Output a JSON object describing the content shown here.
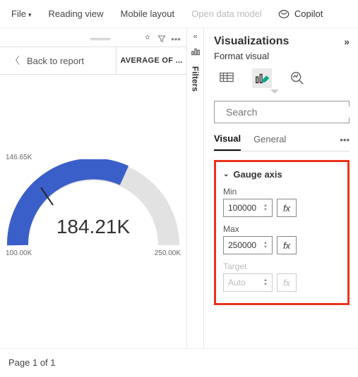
{
  "topbar": {
    "file": "File",
    "reading_view": "Reading view",
    "mobile_layout": "Mobile layout",
    "open_data_model": "Open data model",
    "copilot": "Copilot"
  },
  "canvas": {
    "back_to_report": "Back to report",
    "visual_title": "AVERAGE OF ...",
    "gauge": {
      "pointer_label": "146.65K",
      "value_display": "184.21K",
      "min_label": "100.00K",
      "max_label": "250.00K"
    }
  },
  "filters_rail": {
    "label": "Filters"
  },
  "viz_pane": {
    "title": "Visualizations",
    "subtitle": "Format visual",
    "search_placeholder": "Search",
    "tabs": {
      "visual": "Visual",
      "general": "General"
    },
    "section": {
      "title": "Gauge axis",
      "min_label": "Min",
      "min_value": "100000",
      "max_label": "Max",
      "max_value": "250000",
      "target_label": "Target",
      "target_value": "Auto",
      "fx": "fx"
    }
  },
  "footer": {
    "page_text": "Page 1 of 1"
  },
  "chart_data": {
    "type": "gauge",
    "min": 100000,
    "max": 250000,
    "pointer": 146650,
    "value": 184210,
    "value_display": "184.21K",
    "color_fill": "#3b5fc9",
    "color_empty": "#e2e2e2"
  }
}
